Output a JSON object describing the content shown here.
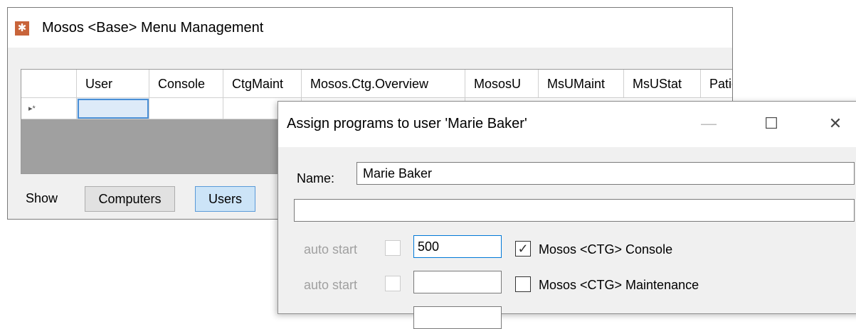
{
  "main_window": {
    "icon": "gear-icon",
    "title": "Mosos <Base> Menu Management",
    "grid": {
      "columns": [
        "User",
        "Console",
        "CtgMaint",
        "Mosos.Ctg.Overview",
        "MososU",
        "MsUMaint",
        "MsUStat",
        "Patie"
      ],
      "new_row_marker": "▸*"
    },
    "show_label": "Show",
    "buttons": {
      "computers": "Computers",
      "users": "Users"
    }
  },
  "dialog": {
    "title": "Assign programs to user 'Marie Baker'",
    "caption_buttons": {
      "minimize": "—",
      "maximize": "☐",
      "close": "✕"
    },
    "name_label": "Name:",
    "name_value": "Marie Baker",
    "second_field_value": "",
    "programs": [
      {
        "auto_start_label": "auto start",
        "auto_start_checked": false,
        "order": "500",
        "checked": true,
        "check_mark": "✓",
        "name": "Mosos <CTG> Console"
      },
      {
        "auto_start_label": "auto start",
        "auto_start_checked": false,
        "order": "",
        "checked": false,
        "check_mark": "",
        "name": "Mosos <CTG> Maintenance"
      }
    ]
  }
}
